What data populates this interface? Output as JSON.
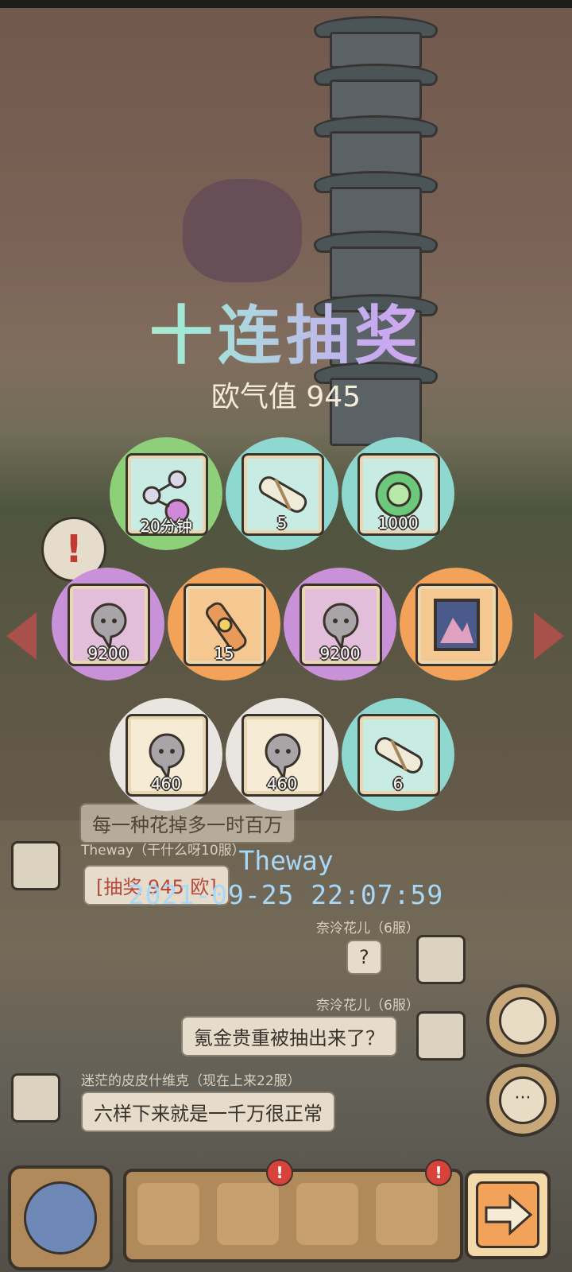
{
  "title": "十连抽奖",
  "luck_label": "欧气值 945",
  "rewards": [
    {
      "name": "flask-icon",
      "count": "20分钟",
      "rarity": "green"
    },
    {
      "name": "scroll-icon",
      "count": "5",
      "rarity": "teal"
    },
    {
      "name": "emblem-icon",
      "count": "1000",
      "rarity": "teal"
    },
    {
      "name": "ghost-soul-icon",
      "count": "9200",
      "rarity": "purple"
    },
    {
      "name": "cannon-icon",
      "count": "15",
      "rarity": "orange"
    },
    {
      "name": "ghost-soul-icon",
      "count": "9200",
      "rarity": "purple"
    },
    {
      "name": "painting-icon",
      "count": "",
      "rarity": "orange"
    },
    {
      "name": "ghost-soul-icon",
      "count": "460",
      "rarity": "white"
    },
    {
      "name": "ghost-soul-icon",
      "count": "460",
      "rarity": "white"
    },
    {
      "name": "scroll-icon",
      "count": "6",
      "rarity": "teal"
    }
  ],
  "winner": {
    "name": "Theway",
    "timestamp": "2021-09-25 22:07:59"
  },
  "chat": {
    "msg0_text": "每一种花掉多一时百万",
    "msg1_user": "Theway（干什么呀10服）",
    "msg1_text": "[抽奖 945 欧]",
    "msg2_user": "奈泠花儿（6服）",
    "msg2_text": "?",
    "msg3_user": "奈泠花儿（6服）",
    "msg3_text": "氪金贵重被抽出来了？",
    "msg4_user": "迷茫的皮皮什维克（现在上来22服）",
    "msg4_text": "六样下来就是一千万很正常"
  },
  "alert_mark": "!",
  "colors": {
    "green": "#8ed07a",
    "teal": "#8fd8d0",
    "purple": "#c991d8",
    "orange": "#f2a259",
    "white": "#e9e6e2",
    "timestamp": "#a8d8f8",
    "badge": "#d8423a"
  },
  "dock": {
    "items": [
      "snail-icon",
      "backpack-icon",
      "statue-icon",
      "pyramid-icon"
    ],
    "badge": "!"
  }
}
